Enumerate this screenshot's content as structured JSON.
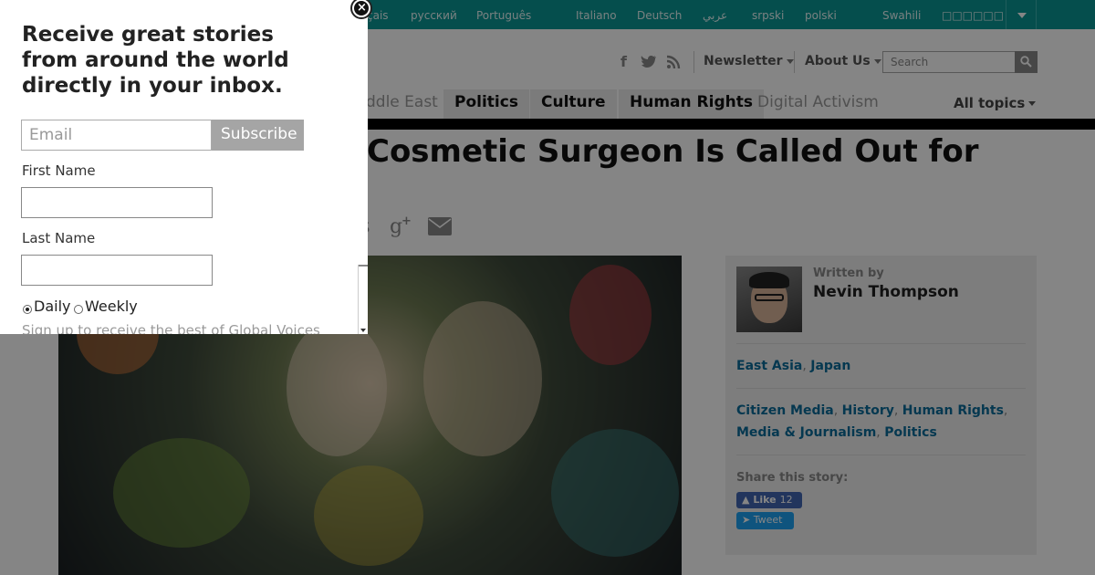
{
  "languages": [
    "çais",
    "русский",
    "Português",
    "Italiano",
    "Deutsch",
    "عربي",
    "srpski",
    "polski",
    "Swahili",
    "□□□□□□"
  ],
  "header": {
    "newsletter_label": "Newsletter",
    "about_label": "About Us",
    "search_placeholder": "Search"
  },
  "topics": [
    "ddle East",
    "Politics",
    "Culture",
    "Human Rights",
    "Digital Activism"
  ],
  "all_topics_label": "All topics",
  "article": {
    "title": "Cosmetic Surgeon Is Called Out for",
    "share_glyph": "s"
  },
  "sidebar": {
    "written_by": "Written by",
    "author": "Nevin Thompson",
    "regions": [
      "East Asia",
      "Japan"
    ],
    "categories": [
      "Citizen Media",
      "History",
      "Human Rights",
      "Media & Journalism",
      "Politics"
    ],
    "share_label": "Share this story:",
    "fb_like_label": "Like",
    "fb_like_count": "12",
    "tweet_label": "Tweet"
  },
  "popup": {
    "heading": "Receive great stories from around the world directly in your inbox.",
    "email_placeholder": "Email",
    "subscribe_label": "Subscribe",
    "first_name_label": "First Name",
    "last_name_label": "Last Name",
    "option_daily": "Daily",
    "option_weekly": "Weekly",
    "note": "Sign up to receive the best of Global Voices",
    "close_glyph": "×"
  },
  "colors": {
    "lang_bar": "#0b9695",
    "link": "#0b6b9a",
    "facebook": "#4267b2",
    "twitter": "#1da1f2"
  }
}
